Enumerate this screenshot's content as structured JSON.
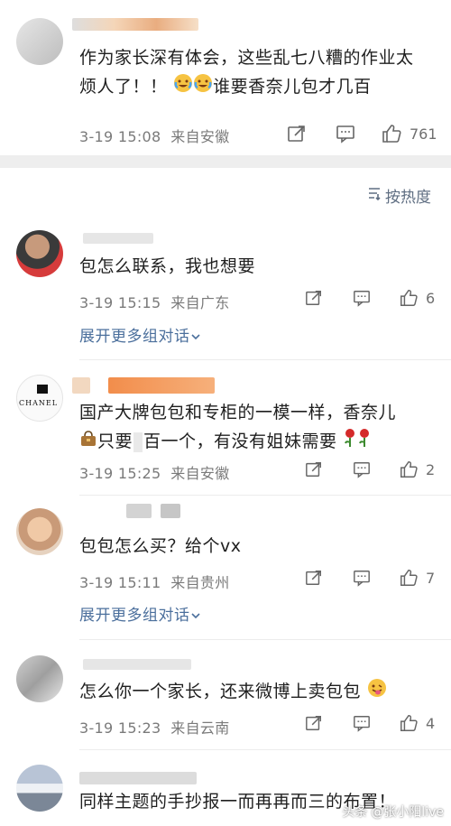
{
  "top_comment": {
    "text_line1": "作为家长深有体会，这些乱七八糟的作业太",
    "text_line2_a": "烦人了！！",
    "text_line2_b": "谁要香奈儿包才几百",
    "time": "3-19 15:08",
    "location": "来自安徽",
    "likes": "761"
  },
  "sort": {
    "label": "按热度"
  },
  "comments": [
    {
      "text": "包怎么联系，我也想要",
      "time": "3-19 15:15",
      "location": "来自广东",
      "likes": "6",
      "expand": "展开更多组对话"
    },
    {
      "text_line1": "国产大牌包包和专柜的一模一样，香奈儿",
      "text_line2": "只要",
      "text_line2_b": "百一个，有没有姐妹需要",
      "time": "3-19 15:25",
      "location": "来自安徽",
      "likes": "2"
    },
    {
      "text": "包包怎么买？给个vx",
      "time": "3-19 15:11",
      "location": "来自贵州",
      "likes": "7",
      "expand": "展开更多组对话"
    },
    {
      "text": "怎么你一个家长，还来微博上卖包包",
      "time": "3-19 15:23",
      "location": "来自云南",
      "likes": "4"
    },
    {
      "text": "同样主题的手抄报一而再再而三的布置！"
    }
  ],
  "watermark": {
    "source": "头条",
    "author": "@张小阳live"
  },
  "colors": {
    "link": "#4b6f9c",
    "meta": "#7a7a7a",
    "divider": "#f1f1f1"
  }
}
